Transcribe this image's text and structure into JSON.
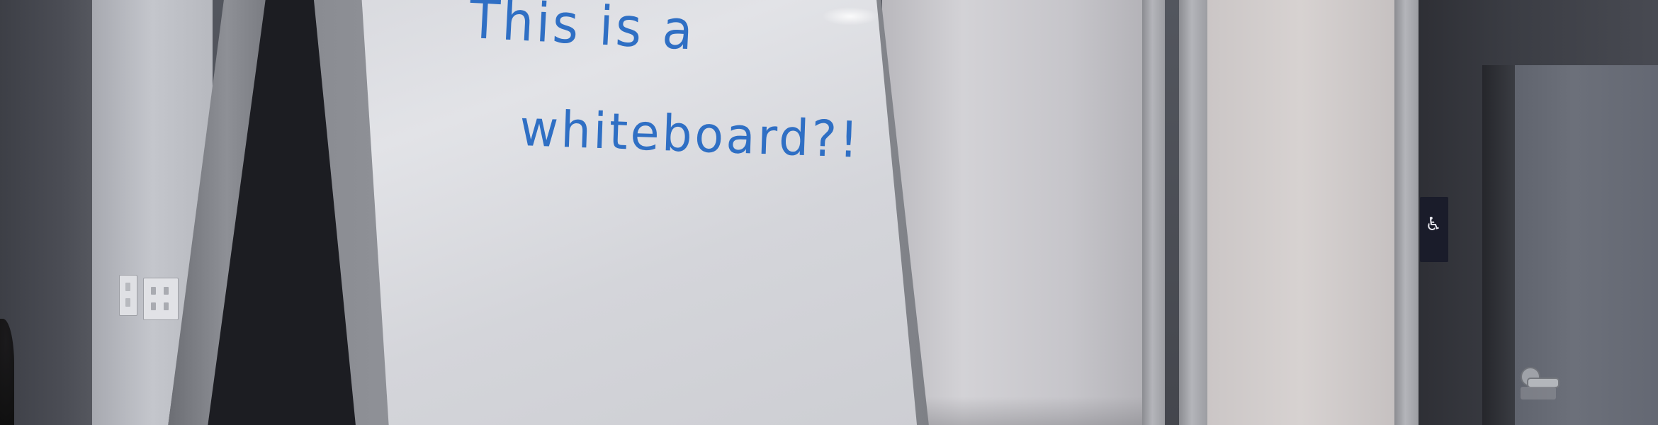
{
  "photo": {
    "subject": "whiteboard",
    "board_text": {
      "line_one": "This is a",
      "line_two": "whiteboard?!"
    },
    "colors": {
      "ink": "#2f6fc4",
      "board_surface": "#dcdde1",
      "board_frame": "#8f9197",
      "accessible_sign": "#1a1c2a"
    },
    "icons": {
      "accessible_sign_icon": "wheelchair-icon",
      "door_handle_icon": "door-handle-icon"
    }
  }
}
